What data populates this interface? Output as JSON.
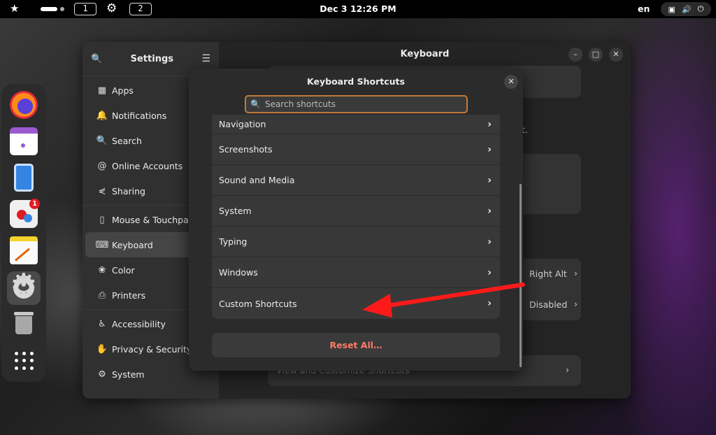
{
  "topbar": {
    "workspace_1": "1",
    "workspace_2": "2",
    "clock": "Dec 3  12:26 PM",
    "language": "en"
  },
  "dock": {
    "badge_count": "1",
    "apps": [
      "firefox-icon",
      "calendar-icon",
      "contacts-icon",
      "software-icon",
      "text-editor-icon",
      "settings-icon",
      "trash-icon",
      "app-grid-icon"
    ]
  },
  "settings": {
    "sidebar_title": "Settings",
    "content_title": "Keyboard",
    "sidebar_groups": [
      [
        {
          "label": "Apps",
          "icon": "▦"
        },
        {
          "label": "Notifications",
          "icon": "🔔"
        },
        {
          "label": "Search",
          "icon": "🔍"
        },
        {
          "label": "Online Accounts",
          "icon": "@"
        },
        {
          "label": "Sharing",
          "icon": "⋞"
        }
      ],
      [
        {
          "label": "Mouse & Touchpad",
          "icon": "▯"
        },
        {
          "label": "Keyboard",
          "icon": "⌨"
        },
        {
          "label": "Color",
          "icon": "❀"
        },
        {
          "label": "Printers",
          "icon": "⎙"
        }
      ],
      [
        {
          "label": "Accessibility",
          "icon": "♿"
        },
        {
          "label": "Privacy & Security",
          "icon": "✋"
        },
        {
          "label": "System",
          "icon": "⚙"
        }
      ]
    ],
    "active_item": "Keyboard",
    "bg_text_ut": "ut.",
    "bg_right_alt": "Right Alt",
    "bg_disabled": "Disabled",
    "bg_view_shortcuts": "View and Customize Shortcuts"
  },
  "dialog": {
    "title": "Keyboard Shortcuts",
    "search_placeholder": "Search shortcuts",
    "search_value": "",
    "rows": [
      "Navigation",
      "Screenshots",
      "Sound and Media",
      "System",
      "Typing",
      "Windows",
      "Custom Shortcuts"
    ],
    "reset_label": "Reset All…"
  },
  "colors": {
    "accent_focus": "#c07a38",
    "destructive": "#ff7b63",
    "annotation_arrow": "#ff1a1a"
  }
}
